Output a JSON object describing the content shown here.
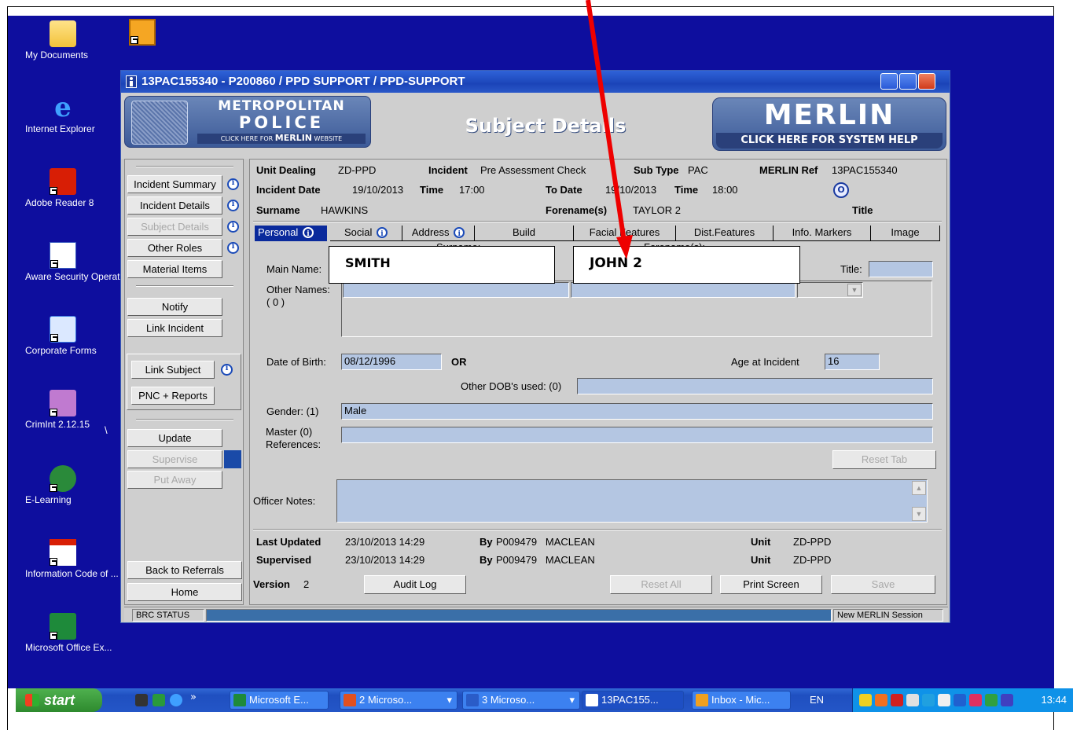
{
  "desktop": {
    "icons": [
      {
        "label": "My Documents",
        "icon": "folder-icon"
      },
      {
        "label": "Internet Explorer",
        "icon": "internet-explorer-icon"
      },
      {
        "label": "Adobe Reader 8",
        "icon": "adobe-reader-icon"
      },
      {
        "label": "Aware Security Operating Pr...",
        "icon": "word-doc-icon"
      },
      {
        "label": "Corporate Forms",
        "icon": "forms-icon"
      },
      {
        "label": "CrimInt 2.12.15",
        "icon": "crimint-icon"
      },
      {
        "label": "E-Learning",
        "icon": "e-learning-icon"
      },
      {
        "label": "Information Code of ...",
        "icon": "pdf-icon"
      },
      {
        "label": "Microsoft Office Ex...",
        "icon": "excel-icon"
      }
    ],
    "stray_char": "\\"
  },
  "window": {
    "title": "13PAC155340 - P200860 / PPD SUPPORT / PPD-SUPPORT"
  },
  "banner": {
    "met_line1": "METROPOLITAN",
    "met_line2": "POLICE",
    "met_line3_pre": "CLICK HERE FOR",
    "met_line3_brand": "MERLIN",
    "met_line3_post": "WEBSITE",
    "heading": "Subject Details",
    "merlin_name": "MERLIN",
    "merlin_help": "CLICK HERE FOR SYSTEM HELP"
  },
  "nav": {
    "incident_summary": "Incident Summary",
    "incident_details": "Incident Details",
    "subject_details": "Subject Details",
    "other_roles": "Other Roles",
    "material_items": "Material Items",
    "notify": "Notify",
    "link_incident": "Link Incident",
    "link_subject": "Link Subject",
    "pnc_reports": "PNC + Reports",
    "update": "Update",
    "supervise": "Supervise",
    "put_away": "Put Away",
    "back_to_referrals": "Back to Referrals",
    "home": "Home"
  },
  "header_info": {
    "unit_dealing_label": "Unit Dealing",
    "unit_dealing": "ZD-PPD",
    "incident_label": "Incident",
    "incident": "Pre Assessment Check",
    "sub_type_label": "Sub Type",
    "sub_type": "PAC",
    "merlin_ref_label": "MERLIN Ref",
    "merlin_ref": "13PAC155340",
    "incident_date_label": "Incident Date",
    "incident_date": "19/10/2013",
    "time_label": "Time",
    "time": "17:00",
    "to_date_label": "To Date",
    "to_date": "19/10/2013",
    "to_time_label": "Time",
    "to_time": "18:00",
    "circle_badge": "O",
    "surname_label": "Surname",
    "surname": "HAWKINS",
    "forename_label": "Forename(s)",
    "forename": "TAYLOR 2",
    "title_label": "Title"
  },
  "tabs": [
    {
      "label": "Personal",
      "info": true
    },
    {
      "label": "Social",
      "info": true
    },
    {
      "label": "Address",
      "info": true
    },
    {
      "label": "Build",
      "info": false
    },
    {
      "label": "Facial Features",
      "info": false
    },
    {
      "label": "Dist.Features",
      "info": false
    },
    {
      "label": "Info. Markers",
      "info": false
    },
    {
      "label": "Image",
      "info": false
    }
  ],
  "personal": {
    "surname_col": "Surname:",
    "forename_col": "Forename(s):",
    "main_name_label": "Main Name:",
    "title_label": "Title:",
    "other_names_label": "Other Names:",
    "other_names_count": "( 0 )",
    "dob_label": "Date of Birth:",
    "dob": "08/12/1996",
    "or_label": "OR",
    "age_label": "Age at Incident",
    "age": "16",
    "other_dob_label": "Other DOB's used: (0)",
    "gender_label": "Gender: (1)",
    "gender": "Male",
    "master_label": "Master   (0)",
    "references_label": "References:",
    "reset_tab": "Reset Tab",
    "officer_notes_label": "Officer Notes:"
  },
  "overlay": {
    "surname": "SMITH",
    "forename": "JOHN 2"
  },
  "footer": {
    "last_updated_label": "Last Updated",
    "last_updated": "23/10/2013 14:29",
    "by_label": "By",
    "last_by": "P009479   MACLEAN",
    "unit_label": "Unit",
    "last_unit": "ZD-PPD",
    "supervised_label": "Supervised",
    "supervised": "23/10/2013 14:29",
    "sup_by": "P009479   MACLEAN",
    "sup_unit": "ZD-PPD",
    "version_label": "Version",
    "version": "2",
    "audit_log": "Audit Log",
    "reset_all": "Reset All",
    "print_screen": "Print Screen",
    "save": "Save"
  },
  "statusbar": {
    "brc": "BRC STATUS",
    "session": "New MERLIN Session"
  },
  "taskbar": {
    "start": "start",
    "chevron": "»",
    "tasks": [
      {
        "label": "Microsoft E...",
        "icon": "excel-icon"
      },
      {
        "label": "2 Microso...",
        "icon": "outlook-icon"
      },
      {
        "label": "3 Microso...",
        "icon": "word-icon"
      },
      {
        "label": "13PAC155...",
        "icon": "merlin-app-icon"
      },
      {
        "label": "Inbox - Mic...",
        "icon": "inbox-icon"
      }
    ],
    "lang": "EN",
    "clock": "13:44"
  },
  "colors": {
    "desktop": "#0e0e9e",
    "field_bg": "#b4c6e2",
    "titlebar": "#2f63d8",
    "arrow": "#ee0000"
  }
}
